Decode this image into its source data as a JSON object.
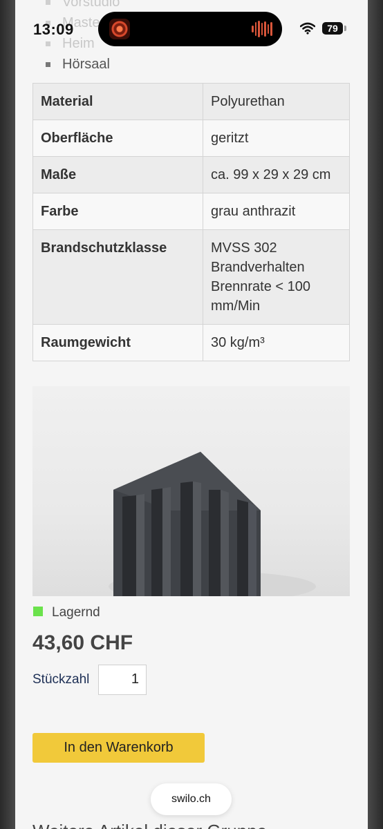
{
  "status_bar": {
    "time": "13:09",
    "battery": "79"
  },
  "usage_list": {
    "items": [
      {
        "label": "Vorstudio",
        "faded": true
      },
      {
        "label": "Master",
        "faded": true
      },
      {
        "label": "Heim",
        "faded": true
      },
      {
        "label": "Hörsaal",
        "faded": false
      }
    ]
  },
  "specs": {
    "rows": [
      {
        "label": "Material",
        "value": "Polyurethan"
      },
      {
        "label": "Oberfläche",
        "value": "geritzt"
      },
      {
        "label": "Maße",
        "value": "ca. 99 x 29 x 29 cm"
      },
      {
        "label": "Farbe",
        "value": "grau anthrazit"
      },
      {
        "label": "Brandschutzklasse",
        "value": "MVSS 302 Brandverhalten Brennrate < 100 mm/Min"
      },
      {
        "label": "Raumgewicht",
        "value": "30 kg/m³"
      }
    ]
  },
  "product": {
    "stock_text": "Lagernd",
    "price": "43,60 CHF",
    "quantity_label": "Stückzahl",
    "quantity_value": "1",
    "cart_button": "In den Warenkorb"
  },
  "browser": {
    "url": "swilo.ch"
  },
  "next_section": {
    "heading": "Weitere Artikel dieser Gruppe"
  },
  "colors": {
    "stock_green": "#6be24c",
    "cart_yellow": "#f1c93a"
  }
}
